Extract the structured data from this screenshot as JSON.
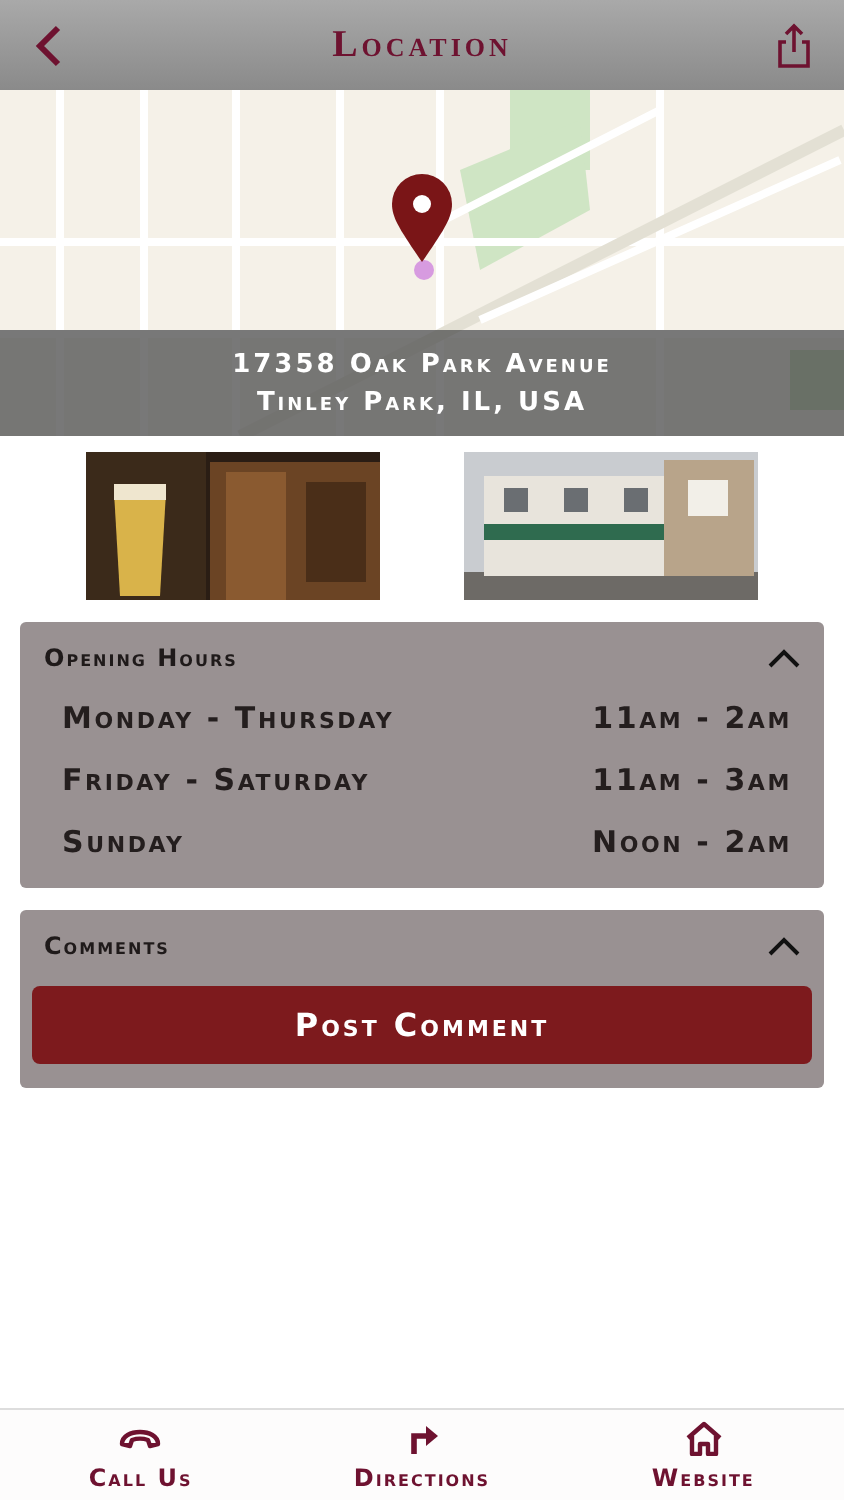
{
  "header": {
    "title": "Location"
  },
  "address": {
    "line_1": "17358 Oak Park Avenue",
    "line_2": "Tinley Park, IL, USA"
  },
  "sections": [
    {
      "title": "Opening Hours",
      "expanded": true,
      "kind": "hours",
      "rows": [
        {
          "days": "Monday - Thursday",
          "hours": "11am - 2am"
        },
        {
          "days": "Friday - Saturday",
          "hours": "11am - 3am"
        },
        {
          "days": "Sunday",
          "hours": "Noon - 2am"
        }
      ]
    },
    {
      "title": "Comments",
      "expanded": true,
      "kind": "comments",
      "button": "Post Comment"
    }
  ],
  "tab_bar": [
    {
      "label": "Call Us",
      "kind": "phone"
    },
    {
      "label": "Directions",
      "kind": "directions"
    },
    {
      "label": "Website",
      "kind": "home"
    }
  ]
}
